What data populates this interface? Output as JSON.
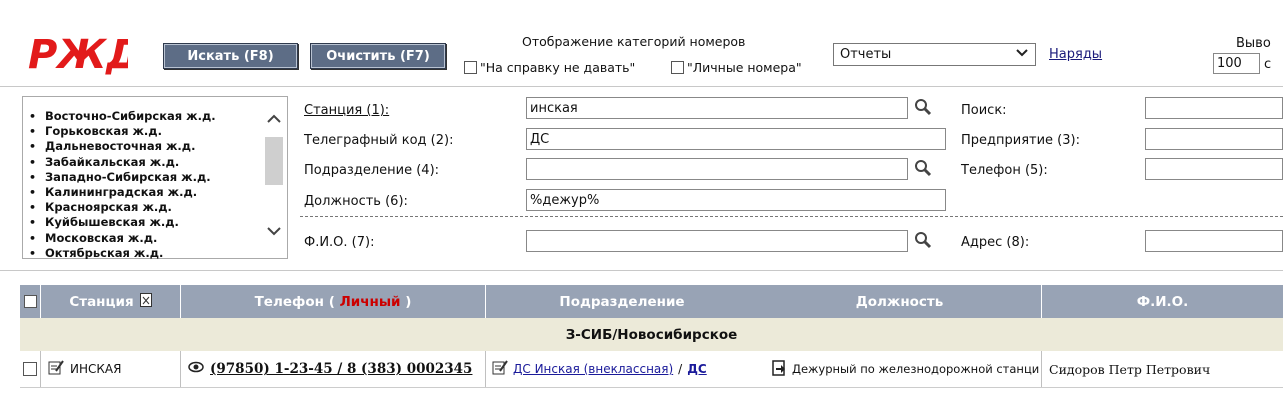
{
  "header": {
    "logo_text": "РЖД",
    "search_button": "Искать (F8)",
    "clear_button": "Очистить (F7)",
    "category_title": "Отображение категорий номеров",
    "category_option1": "\"На справку не давать\"",
    "category_option2": "\"Личные номера\"",
    "report_select": "Отчеты",
    "orders_link": "Наряды",
    "output_label": "Выво",
    "output_count": "100",
    "output_suffix": "с"
  },
  "roads": [
    "Восточно-Сибирская ж.д.",
    "Горьковская ж.д.",
    "Дальневосточная ж.д.",
    "Забайкальская ж.д.",
    "Западно-Сибирская ж.д.",
    "Калининградская ж.д.",
    "Красноярская ж.д.",
    "Куйбышевская ж.д.",
    "Московская ж.д.",
    "Октябрьская ж.д."
  ],
  "form": {
    "station_label": "Станция (1):",
    "station_value": "инская",
    "telegraph_label": "Телеграфный код (2):",
    "telegraph_value": "ДС",
    "division_label": "Подразделение (4):",
    "division_value": "",
    "position_label": "Должность (6):",
    "position_value": "%дежур%",
    "fio_label": "Ф.И.О. (7):",
    "fio_value": "",
    "search_label": "Поиск:",
    "enterprise_label": "Предприятие (3):",
    "phone_label": "Телефон (5):",
    "address_label": "Адрес (8):"
  },
  "table": {
    "col_station": "Станция",
    "col_phone_prefix": "Телефон (",
    "col_phone_personal": "Личный",
    "col_phone_suffix": ")",
    "col_division": "Подразделение",
    "col_position": "Должность",
    "col_fio": "Ф.И.О.",
    "group_title": "З-СИБ/Новосибирское",
    "row": {
      "station": "ИНСКАЯ",
      "phone": "(97850) 1-23-45 / 8 (383) 0002345",
      "division_link": "ДС Инская (внеклассная)",
      "division_sep": "/",
      "division_code": "ДС",
      "position": "Дежурный по железнодорожной станции",
      "fio": "Сидоров Петр Петрович"
    }
  },
  "colors": {
    "brand_red": "#e21a1a",
    "header_bg": "#98a3b5",
    "button_bg": "#5d6d86",
    "personal_red": "#cc0000"
  }
}
